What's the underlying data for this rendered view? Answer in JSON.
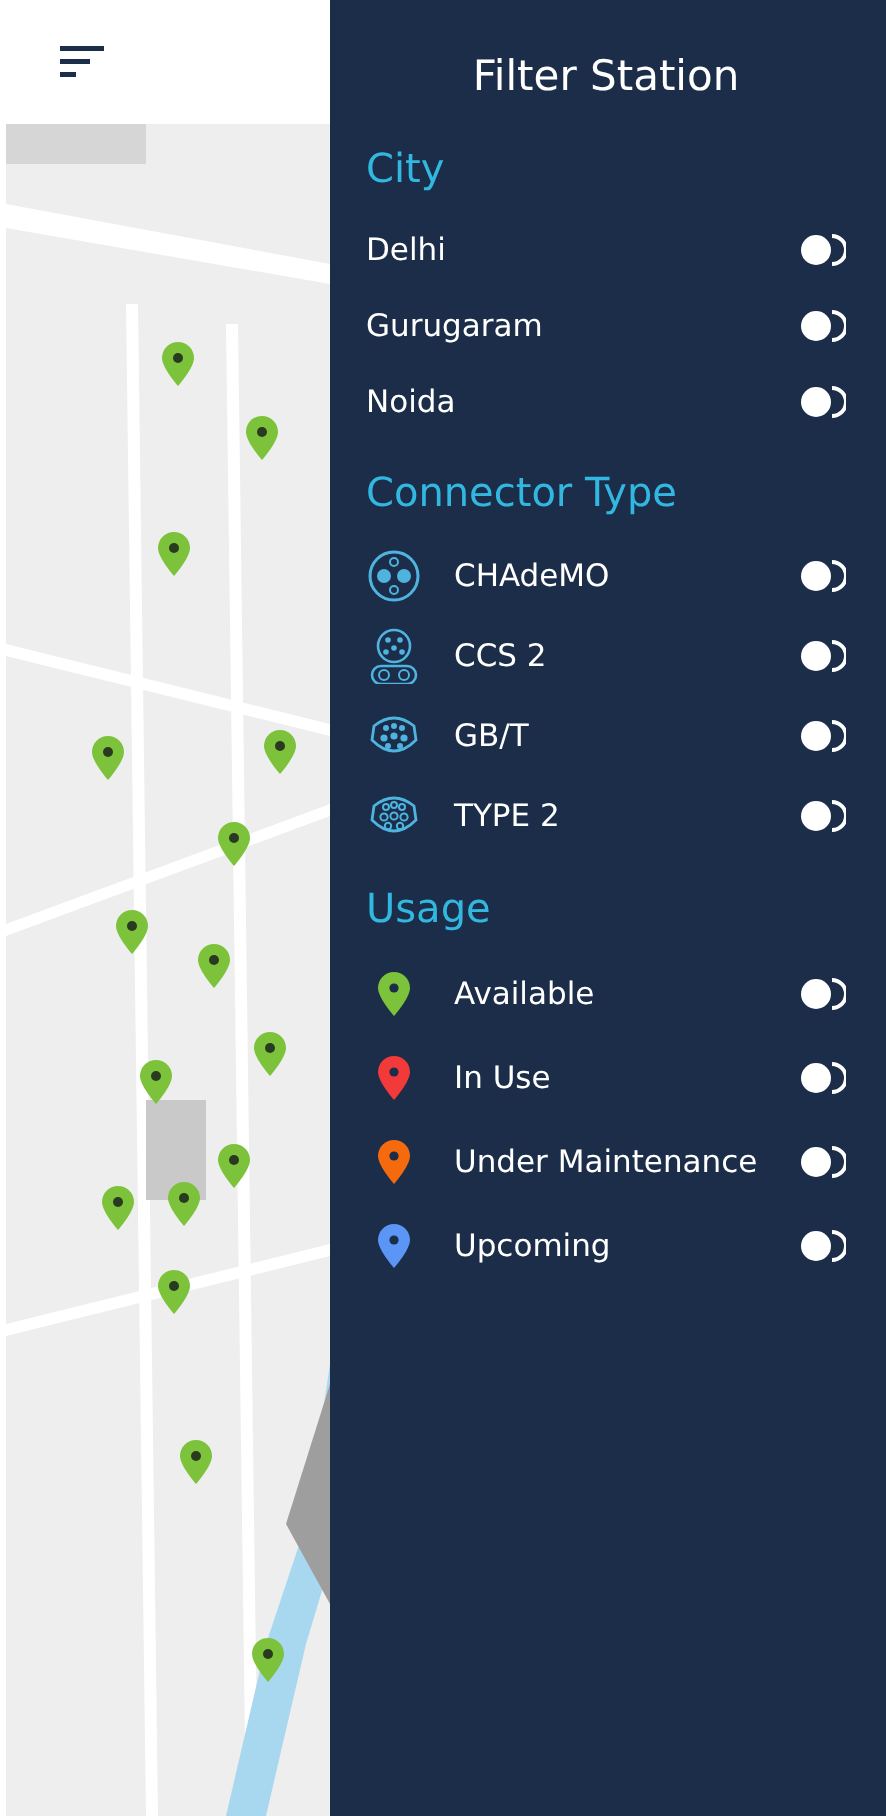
{
  "panel": {
    "title": "Filter Station"
  },
  "sections": [
    {
      "heading": "City",
      "items": [
        {
          "kind": "plain",
          "label": "Delhi",
          "on": false
        },
        {
          "kind": "plain",
          "label": "Gurugaram",
          "on": false
        },
        {
          "kind": "plain",
          "label": "Noida",
          "on": false
        }
      ]
    },
    {
      "heading": "Connector Type",
      "items": [
        {
          "kind": "chademo",
          "label": "CHAdeMO",
          "on": false
        },
        {
          "kind": "ccs2",
          "label": "CCS 2",
          "on": false
        },
        {
          "kind": "gbt",
          "label": "GB/T",
          "on": false
        },
        {
          "kind": "type2",
          "label": "TYPE 2",
          "on": false
        }
      ]
    },
    {
      "heading": "Usage",
      "items": [
        {
          "kind": "pin",
          "label": "Available",
          "color": "#7cc23a",
          "on": false
        },
        {
          "kind": "pin",
          "label": "In Use",
          "color": "#f23a3a",
          "on": false
        },
        {
          "kind": "pin",
          "label": "Under Maintenance",
          "color": "#f56a0c",
          "on": false
        },
        {
          "kind": "pin",
          "label": "Upcoming",
          "color": "#5b95f5",
          "on": false
        }
      ]
    }
  ]
}
